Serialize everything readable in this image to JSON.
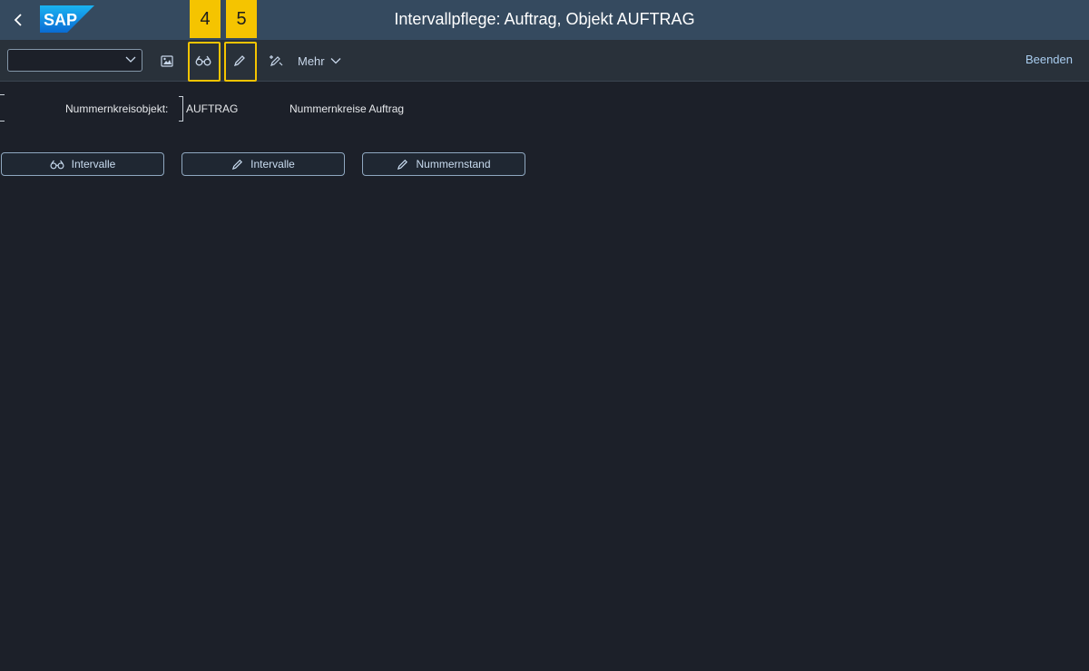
{
  "shell": {
    "logo_text": "SAP",
    "title": "Intervallpflege: Auftrag, Objekt AUFTRAG"
  },
  "toolbar": {
    "command_field_value": "",
    "more_label": "Mehr",
    "exit_label": "Beenden",
    "highlights": [
      {
        "number": "4",
        "target": "display-intervals"
      },
      {
        "number": "5",
        "target": "change-intervals"
      }
    ]
  },
  "form": {
    "object_label": "Nummernkreisobjekt:",
    "object_value": "AUFTRAG",
    "object_description": "Nummernkreise Auftrag"
  },
  "actions": [
    {
      "label": "Intervalle",
      "icon": "glasses-icon"
    },
    {
      "label": "Intervalle",
      "icon": "pencil-icon"
    },
    {
      "label": "Nummernstand",
      "icon": "pencil-icon"
    }
  ],
  "colors": {
    "shell_bg": "#354a5f",
    "toolbar_bg": "#29313a",
    "page_bg": "#1c2029",
    "highlight": "#f5c400",
    "link": "#a9cdf0"
  }
}
